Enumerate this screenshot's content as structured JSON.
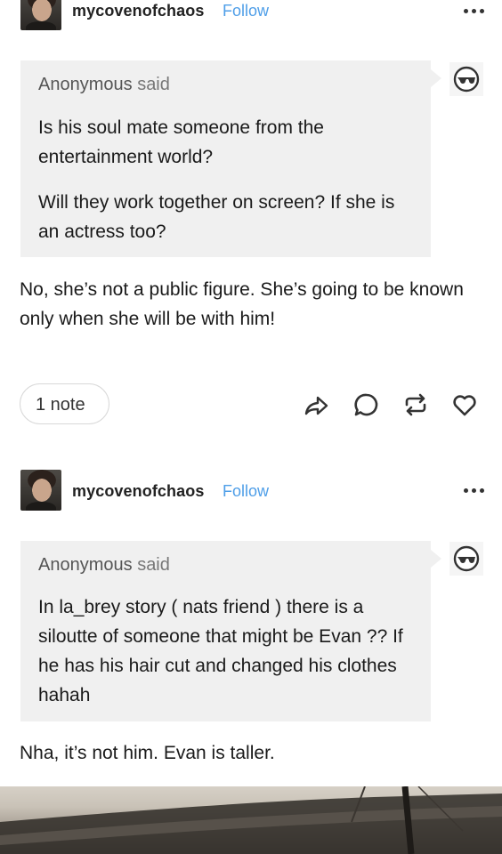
{
  "posts": [
    {
      "username": "mycovenofchaos",
      "follow_label": "Follow",
      "ask": {
        "asker": "Anonymous",
        "said": "said",
        "paragraphs": [
          "Is his soul mate someone from the entertainment world?",
          "Will they work together on screen? If she is an actress too?"
        ]
      },
      "answer": "No, she’s not a public figure. She’s going to be known only when she will be with him!",
      "notes": "1 note",
      "actions": [
        "share-icon",
        "comment-icon",
        "reblog-icon",
        "heart-icon"
      ]
    },
    {
      "username": "mycovenofchaos",
      "follow_label": "Follow",
      "ask": {
        "asker": "Anonymous",
        "said": "said",
        "paragraphs": [
          "In la_brey story ( nats friend ) there is a siloutte of someone that might be Evan ?? If he has his hair cut and changed his clothes hahah"
        ]
      },
      "answer": "Nha, it’s not him. Evan is taller."
    }
  ],
  "colors": {
    "follow": "#4e9ee8",
    "ask_bg": "#f0f0f0",
    "text": "#1a1a1a"
  }
}
